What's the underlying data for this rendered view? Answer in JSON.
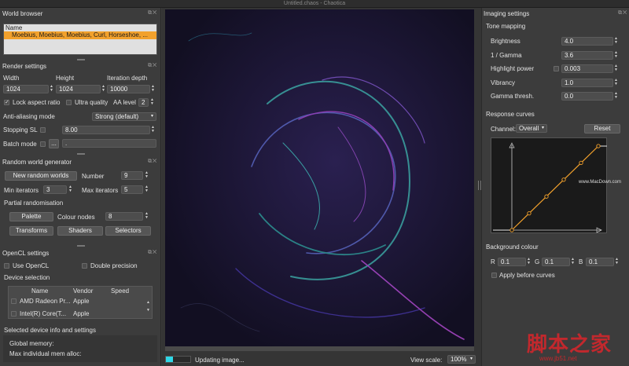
{
  "window": {
    "title": "Untitled.chaos - Chaotica"
  },
  "world_browser": {
    "title": "World browser",
    "column_name": "Name",
    "selected_item": "Moebius, Moebius, Moebius, Curl, Horseshoe, ..."
  },
  "render_settings": {
    "title": "Render settings",
    "width_label": "Width",
    "height_label": "Height",
    "iter_label": "Iteration depth",
    "width": "1024",
    "height": "1024",
    "iteration_depth": "10000",
    "lock_aspect": "Lock aspect ratio",
    "ultra_quality": "Ultra quality",
    "aa_level_label": "AA level",
    "aa_level": "2",
    "aa_mode_label": "Anti-aliasing mode",
    "aa_mode": "Strong (default)",
    "stopping_sl_label": "Stopping SL",
    "stopping_sl": "8.00",
    "batch_mode_label": "Batch mode",
    "batch_btn": "...",
    "batch_value": "."
  },
  "random_world": {
    "title": "Random world generator",
    "new_btn": "New random worlds",
    "number_label": "Number",
    "number": "9",
    "min_label": "Min iterators",
    "min": "3",
    "max_label": "Max iterators",
    "max": "5",
    "partial": "Partial randomisation",
    "palette_btn": "Palette",
    "colour_nodes_label": "Colour nodes",
    "colour_nodes": "8",
    "transforms_btn": "Transforms",
    "shaders_btn": "Shaders",
    "selectors_btn": "Selectors"
  },
  "opencl": {
    "title": "OpenCL settings",
    "use_opencl": "Use OpenCL",
    "double_precision": "Double precision",
    "device_selection": "Device selection",
    "columns": [
      "Name",
      "Vendor",
      "Speed"
    ],
    "devices": [
      {
        "name": "AMD Radeon Pr...",
        "vendor": "Apple",
        "speed": ""
      },
      {
        "name": "Intel(R) Core(T...",
        "vendor": "Apple",
        "speed": ""
      }
    ],
    "info_title": "Selected device info and settings",
    "global_memory": "Global memory:",
    "max_alloc": "Max individual mem alloc:"
  },
  "status": {
    "updating": "Updating image...",
    "view_scale_label": "View scale:",
    "view_scale": "100%",
    "progress": 0.3
  },
  "imaging": {
    "title": "Imaging settings",
    "tone_mapping": "Tone mapping",
    "rows": [
      {
        "label": "Brightness",
        "value": "4.0"
      },
      {
        "label": "1 / Gamma",
        "value": "3.6"
      },
      {
        "label": "Highlight power",
        "value": "0.003"
      },
      {
        "label": "Vibrancy",
        "value": "1.0"
      },
      {
        "label": "Gamma thresh.",
        "value": "0.0"
      }
    ],
    "response_curves": "Response curves",
    "channel_label": "Channel:",
    "channel": "Overall",
    "reset_btn": "Reset",
    "curve_points": [
      [
        0,
        0
      ],
      [
        0.2,
        0.2
      ],
      [
        0.4,
        0.4
      ],
      [
        0.6,
        0.6
      ],
      [
        0.8,
        0.8
      ],
      [
        1,
        1
      ]
    ],
    "background_colour": "Background colour",
    "r_label": "R",
    "r": "0.1",
    "g_label": "G",
    "g": "0.1",
    "b_label": "B",
    "b": "0.1",
    "apply_before": "Apply before curves",
    "accent": "#f2a12c"
  },
  "watermark": {
    "url": "www.MacDown.com",
    "site_cn": "脚本之家",
    "site_url": "www.jb51.net"
  }
}
